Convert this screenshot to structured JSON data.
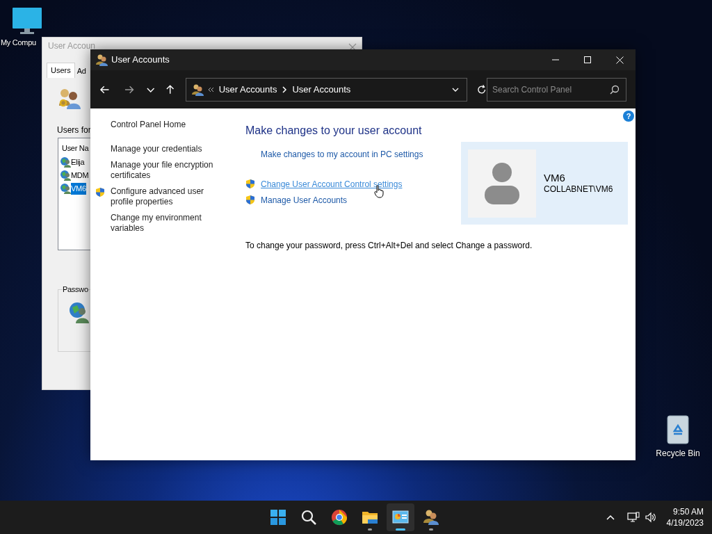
{
  "desktop_icons": [
    {
      "kind": "computer",
      "label": "My Compu"
    },
    {
      "kind": "recycle-bin",
      "label": "Recycle Bin"
    }
  ],
  "back_window": {
    "title": "User Accoun",
    "tabs": [
      {
        "label": "Users",
        "selected": true
      },
      {
        "label": "Ad",
        "selected": false
      }
    ],
    "users_for_label": "Users for",
    "column_header": "User Na",
    "users": [
      {
        "name": "Elija",
        "selected": false
      },
      {
        "name": "MDM",
        "selected": false
      },
      {
        "name": "VM6",
        "selected": true
      }
    ],
    "password_group": "Passwo"
  },
  "window": {
    "title": "User Accounts",
    "help_glyph": "?",
    "breadcrumb": [
      "User Accounts",
      "User Accounts"
    ],
    "search": {
      "placeholder": "Search Control Panel"
    }
  },
  "sidebar": {
    "items": [
      {
        "label": "Control Panel Home",
        "shield": false
      },
      {
        "label": "Manage your credentials",
        "shield": false
      },
      {
        "label": "Manage your file encryption certificates",
        "shield": false
      },
      {
        "label": "Configure advanced user profile properties",
        "shield": true
      },
      {
        "label": "Change my environment variables",
        "shield": false
      }
    ]
  },
  "main": {
    "heading": "Make changes to your user account",
    "links": [
      {
        "label": "Make changes to my account in PC settings",
        "shield": false,
        "hovered": false
      },
      {
        "label": "Change User Account Control settings",
        "shield": true,
        "hovered": true
      },
      {
        "label": "Manage User Accounts",
        "shield": true,
        "hovered": false
      }
    ],
    "account": {
      "name": "VM6",
      "domain": "COLLABNET\\VM6"
    },
    "note": "To change your password, press Ctrl+Alt+Del and select Change a password."
  },
  "taskbar": {
    "apps": [
      {
        "kind": "start",
        "running": false,
        "active": false
      },
      {
        "kind": "search",
        "running": false,
        "active": false
      },
      {
        "kind": "browser",
        "running": false,
        "active": false
      },
      {
        "kind": "folder",
        "running": true,
        "active": false
      },
      {
        "kind": "control-panel",
        "running": true,
        "active": true
      },
      {
        "kind": "users",
        "running": true,
        "active": false
      }
    ],
    "time": "9:50 AM",
    "date": "4/19/2023"
  }
}
